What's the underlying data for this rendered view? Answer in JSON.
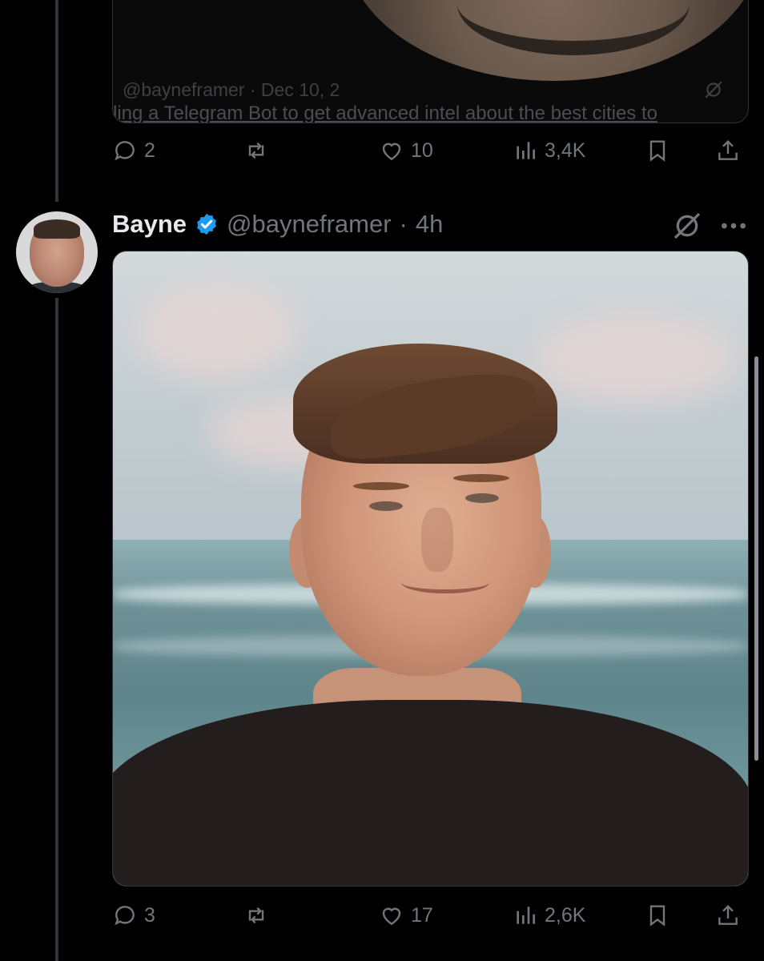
{
  "previous_post": {
    "quote": {
      "meta": "@bayneframer · Dec 10, 2",
      "text": "ling a Telegram Bot to get advanced intel about the best cities to"
    },
    "actions": {
      "replies": "2",
      "likes": "10",
      "views": "3,4K"
    }
  },
  "tweet": {
    "author_name": "Bayne",
    "handle": "@bayneframer",
    "separator": "·",
    "time": "4h",
    "verified": true,
    "actions": {
      "replies": "3",
      "likes": "17",
      "views": "2,6K"
    }
  },
  "icons": {
    "reply": "reply-icon",
    "retweet": "retweet-icon",
    "like": "heart-icon",
    "views": "views-icon",
    "bookmark": "bookmark-icon",
    "share": "share-icon",
    "grok": "grok-icon",
    "more": "more-icon",
    "verified": "verified-badge-icon"
  },
  "colors": {
    "background": "#000000",
    "text_primary": "#e7e9ea",
    "text_secondary": "#71767b",
    "border": "#2f3336",
    "verified": "#1d9bf0"
  }
}
